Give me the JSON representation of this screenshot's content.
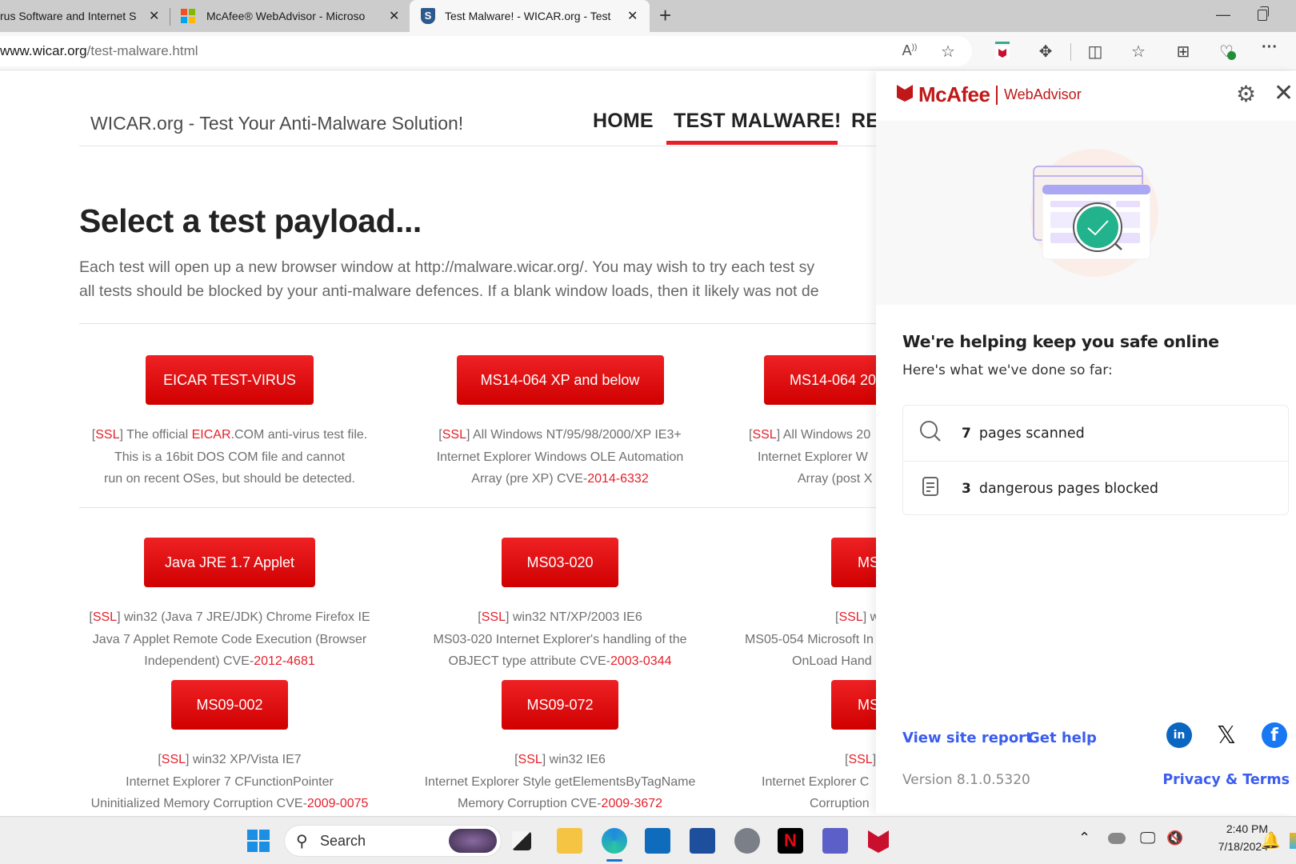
{
  "browser": {
    "tabs": [
      {
        "title": "rus Software and Internet S",
        "active": false
      },
      {
        "title": "McAfee® WebAdvisor - Microso",
        "active": false
      },
      {
        "title": "Test Malware! - WICAR.org - Test",
        "active": true
      }
    ],
    "url_domain": "www.wicar.org",
    "url_path": "/test-malware.html"
  },
  "site": {
    "title": "WICAR.org - Test Your Anti-Malware Solution!",
    "nav": [
      "HOME",
      "TEST MALWARE!",
      "RE"
    ],
    "active_nav": "TEST MALWARE!",
    "heading": "Select a test payload...",
    "intro_line1": "Each test will open up a new browser window at http://malware.wicar.org/. You may wish to try each test sy",
    "intro_line2": "all tests should be blocked by your anti-malware defences. If a blank window loads, then it likely was not de",
    "payloads": [
      {
        "button": "EICAR TEST-VIRUS",
        "ssl": "SSL",
        "line1": "The official ",
        "link": "EICAR",
        "line1b": ".COM anti-virus test file.",
        "line2": "This is a 16bit DOS COM file and cannot",
        "line3": "run on recent OSes, but should be detected."
      },
      {
        "button": "MS14-064 XP and below",
        "ssl": "SSL",
        "line1": "All Windows NT/95/98/2000/XP IE3+",
        "line2": "Internet Explorer Windows OLE Automation",
        "line3_pre": "Array (pre  XP) CVE-",
        "cve": "2014-6332"
      },
      {
        "button": "MS14-064 20",
        "ssl": "SSL",
        "line1": "All Windows 20",
        "line2": "Internet Explorer W",
        "line3": "Array (post X"
      },
      {
        "button": "Java JRE 1.7 Applet",
        "ssl": "SSL",
        "line1": "win32 (Java 7 JRE/JDK) Chrome Firefox IE",
        "line2": "Java 7 Applet Remote Code Execution (Browser",
        "line3_pre": "Independent) CVE-",
        "cve": "2012-4681"
      },
      {
        "button": "MS03-020",
        "ssl": "SSL",
        "line1": "win32 NT/XP/2003 IE6",
        "line2": "MS03-020 Internet Explorer's handling of the",
        "line3_pre": "OBJECT type attribute CVE-",
        "cve": "2003-0344"
      },
      {
        "button": "MS",
        "ssl": "SSL",
        "line1": "w",
        "line2": "MS05-054 Microsoft In",
        "line3": "OnLoad Hand"
      },
      {
        "button": "MS09-002",
        "ssl": "SSL",
        "line1": "win32 XP/Vista IE7",
        "line2": "Internet Explorer 7 CFunctionPointer",
        "line3_pre": "Uninitialized Memory Corruption CVE-",
        "cve": "2009-0075"
      },
      {
        "button": "MS09-072",
        "ssl": "SSL",
        "line1": "win32 IE6",
        "line2": "Internet Explorer Style getElementsByTagName",
        "line3_pre": "Memory Corruption CVE-",
        "cve": "2009-3672"
      },
      {
        "button": "MS",
        "ssl": "SSL",
        "line1": "",
        "line2": "Internet Explorer C",
        "line3": "Corruption"
      }
    ]
  },
  "mcafee": {
    "brand": "McAfee",
    "product": "WebAdvisor",
    "status_title": "We're helping keep you safe online",
    "status_sub": "Here's what we've done so far:",
    "stats": [
      {
        "icon": "search-icon",
        "count": "7",
        "label": "pages scanned"
      },
      {
        "icon": "document-icon",
        "count": "3",
        "label": "dangerous pages blocked"
      }
    ],
    "links": {
      "site_report": "View site report",
      "help": "Get help",
      "privacy": "Privacy & Terms"
    },
    "version": "Version 8.1.0.5320",
    "social": [
      "linkedin",
      "x",
      "facebook"
    ],
    "brand_color": "#c01818",
    "link_color": "#3a5cf0"
  },
  "taskbar": {
    "search_label": "Search",
    "time": "2:40 PM",
    "date": "7/18/2024"
  }
}
